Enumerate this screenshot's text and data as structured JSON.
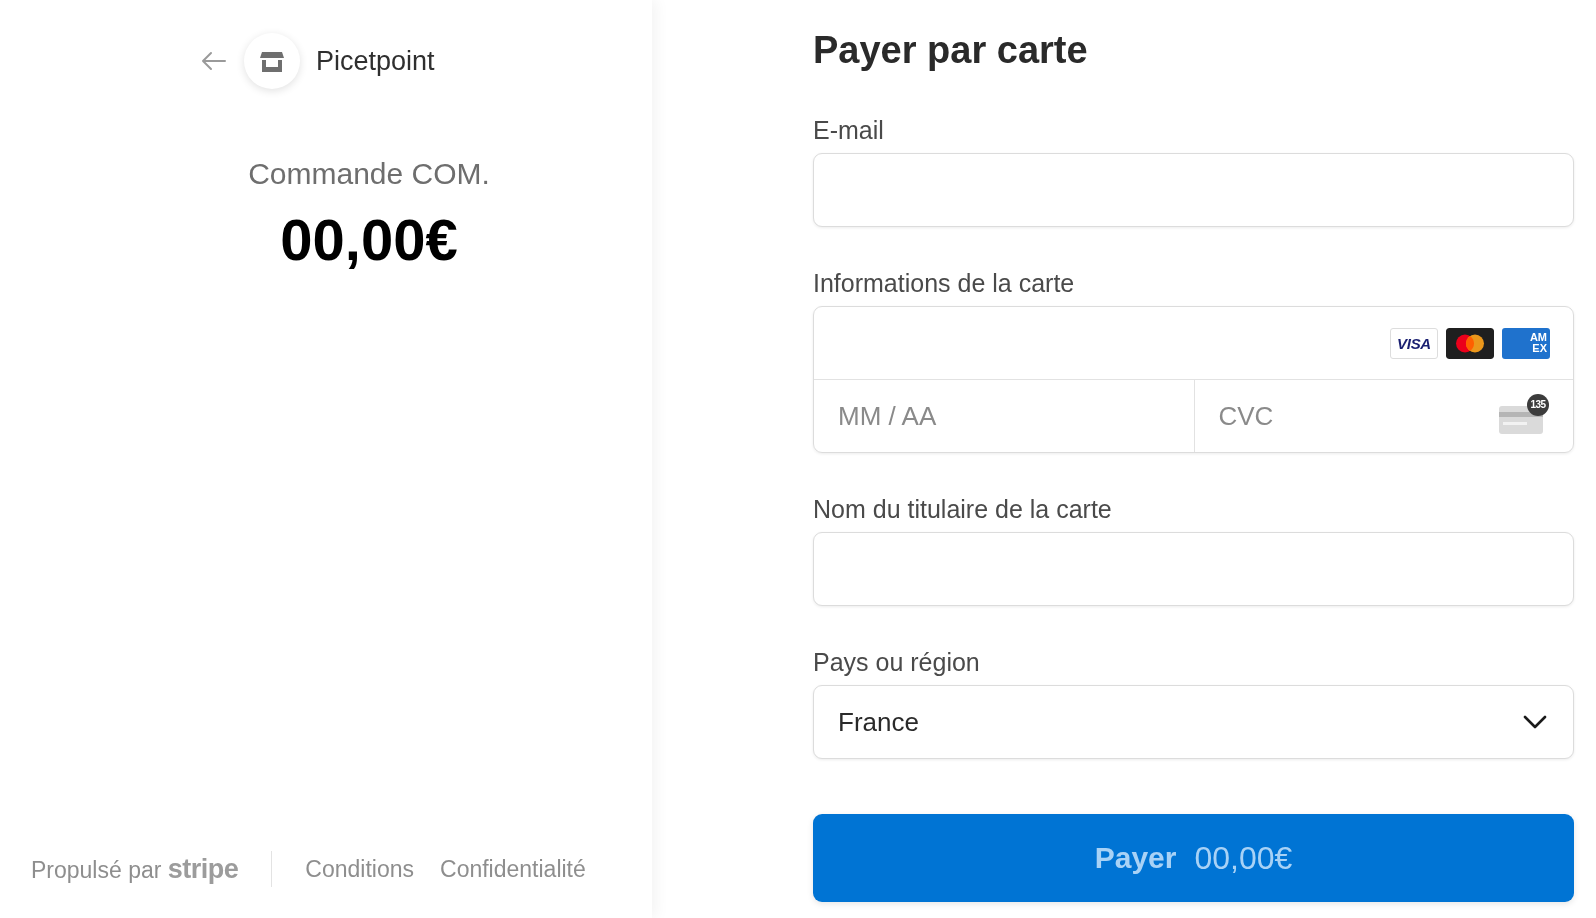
{
  "merchant": {
    "name": "Picetpoint"
  },
  "order": {
    "title": "Commande COM.",
    "amount": "00,00€"
  },
  "footer": {
    "powered_by": "Propulsé par **stripe**",
    "links": [
      "Conditions",
      "Confidentialité"
    ]
  },
  "form": {
    "title": "Payer par carte",
    "fields": [
      {
        "kind": "text",
        "label": "E-mail"
      },
      {
        "kind": "card",
        "label": "Informations de la carte",
        "card_brands": [
          {
            "kind": "visa",
            "label": "VISA"
          },
          {
            "kind": "mastercard"
          },
          {
            "kind": "amex",
            "label": "AM EX"
          }
        ],
        "expiry_placeholder": "MM / AA",
        "cvc_placeholder": "CVC",
        "cvc_badge": "135"
      },
      {
        "kind": "text",
        "label": "Nom du titulaire de la carte"
      },
      {
        "kind": "select",
        "label": "Pays ou région",
        "value": "France"
      }
    ]
  },
  "pay_button": {
    "label": "Payer",
    "amount": "00,00€"
  }
}
